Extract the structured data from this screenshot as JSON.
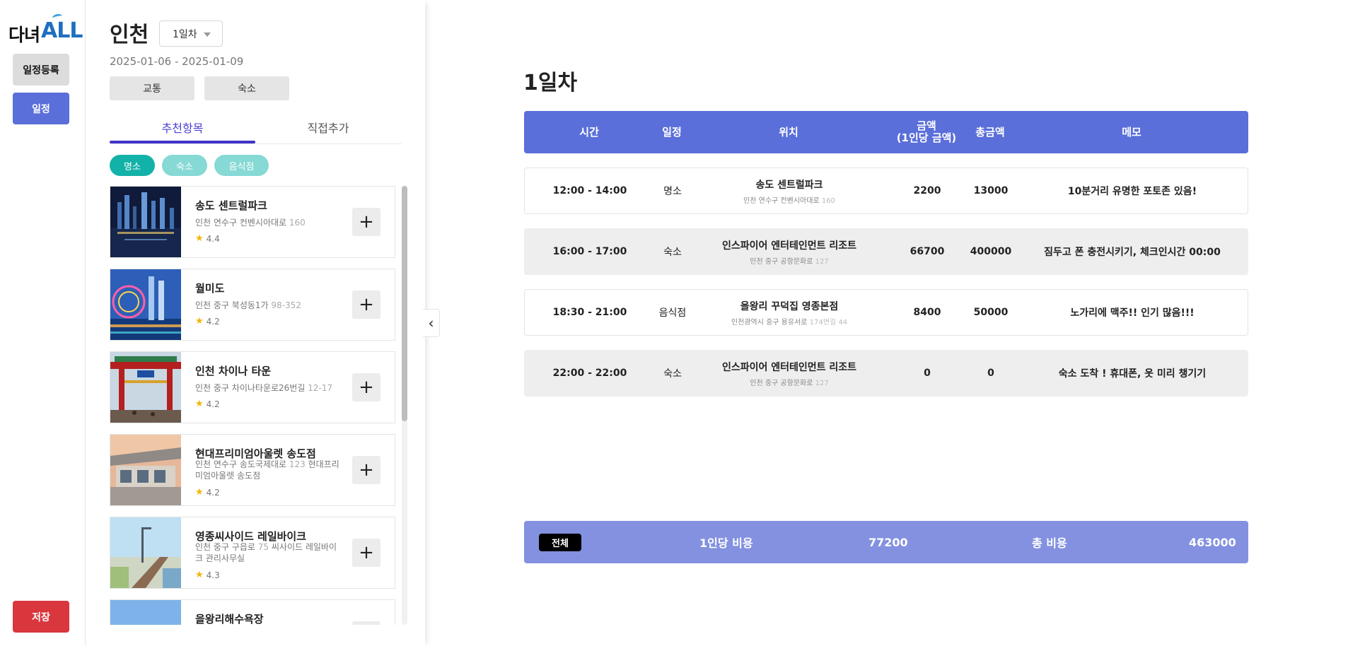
{
  "brand": {
    "logo_ko": "다녀",
    "logo_en": "ALL"
  },
  "rail": {
    "register": "일정등록",
    "schedule": "일정",
    "save": "저장"
  },
  "panel": {
    "city": "인천",
    "day_select": "1일차",
    "dates": "2025-01-06 - 2025-01-09",
    "category_buttons": [
      "교통",
      "숙소"
    ],
    "tabs": [
      "추천항목",
      "직접추가"
    ],
    "chips": [
      "명소",
      "숙소",
      "음식점"
    ],
    "places": [
      {
        "name": "송도 센트럴파크",
        "address": "인천 연수구 컨벤시아대로",
        "address_num": "160",
        "rating": "4.4"
      },
      {
        "name": "월미도",
        "address": "인천 중구 북성동1가",
        "address_num": "98-352",
        "rating": "4.2"
      },
      {
        "name": "인천 차이나 타운",
        "address": "인천 중구 차이나타운로26번길",
        "address_num": "12-17",
        "rating": "4.2"
      },
      {
        "name": "현대프리미엄아울렛 송도점",
        "address": "인천 연수구 송도국제대로",
        "address_num": "123",
        "address_rest": "현대프리미엄아울렛 송도점",
        "rating": "4.2"
      },
      {
        "name": "영종씨사이드 레일바이크",
        "address": "인천 중구 구읍로",
        "address_num": "75",
        "address_rest": "씨사이드 레일바이크 관리사무실",
        "rating": "4.3"
      },
      {
        "name": "을왕리해수욕장"
      }
    ],
    "plus": "+"
  },
  "collapse_icon": "‹",
  "schedule": {
    "title": "1일차",
    "headers": {
      "time": "시간",
      "category": "일정",
      "location": "위치",
      "amount_1": "금액",
      "amount_2": "(1인당 금액)",
      "total": "총금액",
      "memo": "메모"
    },
    "rows": [
      {
        "time": "12:00 - 14:00",
        "category": "명소",
        "place": "송도 센트럴파크",
        "address": "인천 연수구 컨벤시아대로",
        "address_num": "160",
        "amount": "2200",
        "total": "13000",
        "memo": "10분거리 유명한 포토존 있음!"
      },
      {
        "time": "16:00 - 17:00",
        "category": "숙소",
        "place": "인스파이어 엔터테인먼트 리조트",
        "address": "인천 중구 공항문화로",
        "address_num": "127",
        "amount": "66700",
        "total": "400000",
        "memo": "짐두고 폰 충전시키기, 체크인시간 00:00"
      },
      {
        "time": "18:30 - 21:00",
        "category": "음식점",
        "place": "을왕리 꾸덕집 영종본점",
        "address": "인천광역시 중구 용유서로",
        "address_num": "174번길 44",
        "amount": "8400",
        "total": "50000",
        "memo": "노가리에 맥주!! 인기 많음!!!"
      },
      {
        "time": "22:00 - 22:00",
        "category": "숙소",
        "place": "인스파이어 엔터테인먼트 리조트",
        "address": "인천 중구 공항문화로",
        "address_num": "127",
        "amount": "0",
        "total": "0",
        "memo": "숙소 도착 ! 휴대폰, 옷 미리 챙기기"
      }
    ],
    "summary": {
      "badge": "전체",
      "per_person_label": "1인당 비용",
      "per_person_value": "77200",
      "total_label": "총 비용",
      "total_value": "463000"
    }
  },
  "colors": {
    "primary": "#5a6fd9",
    "summary": "#8391e0",
    "save": "#d9363e",
    "chip_active": "#13b2a8",
    "chip_inactive": "#86d9d4",
    "tab_active": "#3f33c9"
  }
}
